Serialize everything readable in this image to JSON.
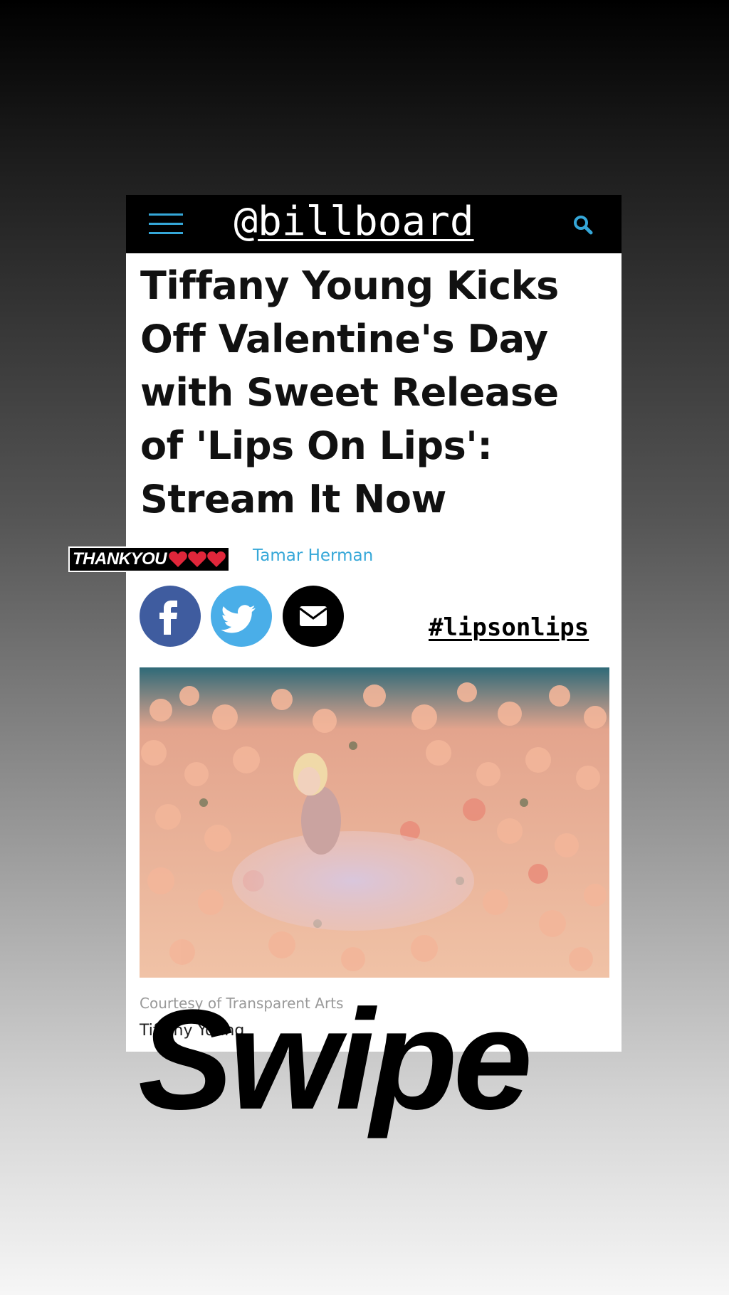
{
  "header": {
    "handle_prefix": "@",
    "handle_name": "billboard",
    "menu_icon": "hamburger-menu-icon",
    "search_icon": "search-icon",
    "accent_color": "#35a7d8"
  },
  "article": {
    "headline": "Tiffany Young Kicks Off Valentine's Day with Sweet Release of 'Lips On Lips': Stream It Now",
    "author": "Tamar Herman",
    "image_caption": "Courtesy of Transparent Arts",
    "image_credit": "Tiffany Young"
  },
  "share": [
    {
      "name": "facebook",
      "icon": "facebook-icon",
      "color": "#3f5c9f"
    },
    {
      "name": "twitter",
      "icon": "twitter-icon",
      "color": "#4aaee8"
    },
    {
      "name": "email",
      "icon": "email-icon",
      "color": "#000000"
    }
  ],
  "stickers": {
    "thanks": "THANKYOU",
    "hearts": "❤️❤️❤️",
    "hashtag": "#lipsonlips",
    "swipe": "Swipe"
  }
}
